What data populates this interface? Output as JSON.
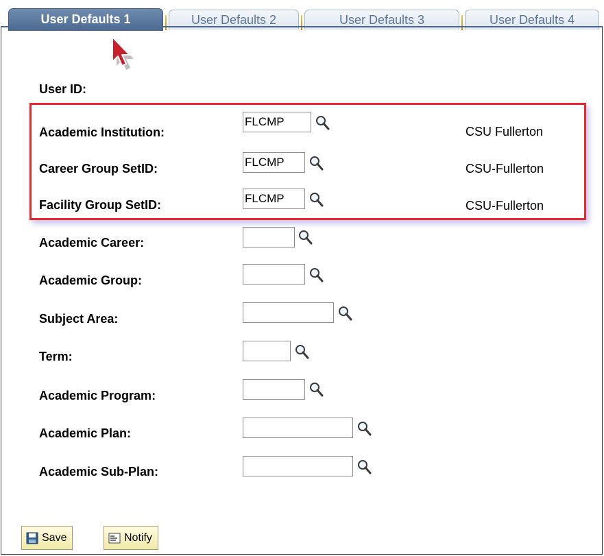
{
  "tabs": [
    {
      "label": "User Defaults 1",
      "active": true
    },
    {
      "label": "User Defaults 2",
      "active": false
    },
    {
      "label": "User Defaults 3",
      "active": false
    },
    {
      "label": "User Defaults 4",
      "active": false
    }
  ],
  "user_id": {
    "label": "User ID:",
    "value": ""
  },
  "fields": [
    {
      "label": "Academic Institution:",
      "value": "FLCMP",
      "description": "CSU Fullerton"
    },
    {
      "label": "Career Group SetID:",
      "value": "FLCMP",
      "description": "CSU-Fullerton"
    },
    {
      "label": "Facility Group SetID:",
      "value": "FLCMP",
      "description": "CSU-Fullerton"
    },
    {
      "label": "Academic Career:",
      "value": ""
    },
    {
      "label": "Academic Group:",
      "value": ""
    },
    {
      "label": "Subject Area:",
      "value": ""
    },
    {
      "label": "Term:",
      "value": ""
    },
    {
      "label": "Academic Program:",
      "value": ""
    },
    {
      "label": "Academic Plan:",
      "value": ""
    },
    {
      "label": "Academic Sub-Plan:",
      "value": ""
    }
  ],
  "icons": {
    "lookup": "magnifier-icon",
    "save": "save-disk-icon",
    "notify": "notify-icon",
    "cursor": "mouse-pointer-icon"
  },
  "buttons": {
    "save_label": "Save",
    "notify_label": "Notify"
  },
  "colors": {
    "highlight": "#e8262e",
    "active_tab": "#4b6991",
    "tab_separator": "#e0a91c"
  }
}
